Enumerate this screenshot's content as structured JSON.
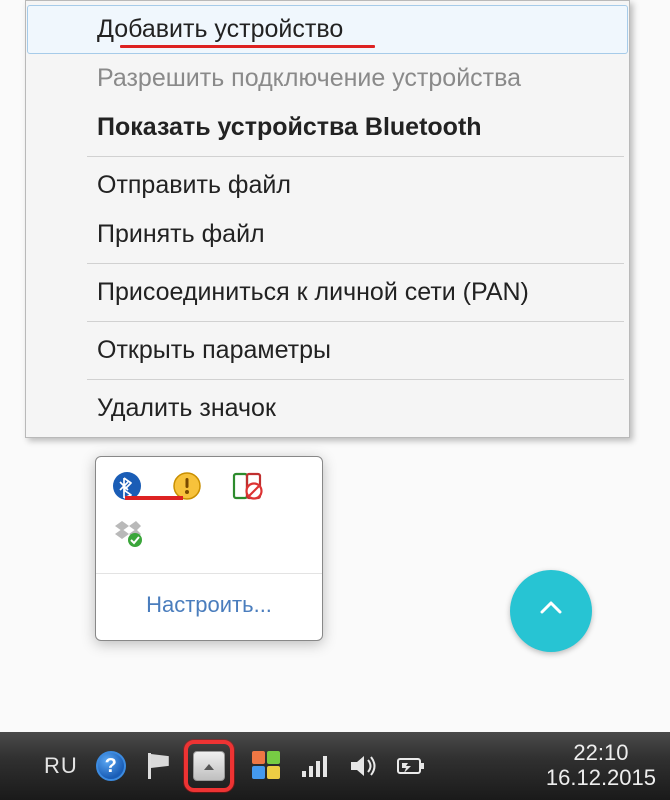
{
  "menu": {
    "items": [
      {
        "label": "Добавить устройство",
        "highlight": true
      },
      {
        "label": "Разрешить подключение устройства",
        "disabled": true
      },
      {
        "label": "Показать устройства Bluetooth",
        "bold": true
      },
      {
        "separator": true
      },
      {
        "label": "Отправить файл"
      },
      {
        "label": "Принять файл"
      },
      {
        "separator": true
      },
      {
        "label": "Присоединиться к личной сети (PAN)"
      },
      {
        "separator": true
      },
      {
        "label": "Открыть параметры"
      },
      {
        "separator": true
      },
      {
        "label": "Удалить значок"
      }
    ]
  },
  "tray_popup": {
    "icons_row1": [
      "bluetooth-icon",
      "warning-icon",
      "blocked-icon"
    ],
    "icons_row2": [
      "dropbox-synced-icon"
    ],
    "customize_label": "Настроить..."
  },
  "fab": {
    "icon": "chevron-up-icon"
  },
  "taskbar": {
    "language": "RU",
    "clock_time": "22:10",
    "clock_date": "16.12.2015",
    "icons": [
      "help-icon",
      "action-center-flag-icon",
      "show-hidden-icons-button",
      "windows-color-icon",
      "network-icon",
      "volume-icon",
      "battery-icon"
    ]
  },
  "colors": {
    "annotation_red": "#d22",
    "fab_bg": "#27c4d3",
    "link_blue": "#4a7dbd"
  }
}
